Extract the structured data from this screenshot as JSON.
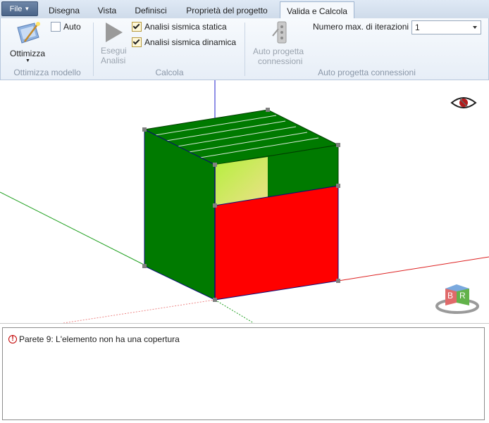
{
  "menu": {
    "file_label": "File",
    "tabs": [
      {
        "label": "Disegna"
      },
      {
        "label": "Vista"
      },
      {
        "label": "Definisci"
      },
      {
        "label": "Proprietà del progetto"
      },
      {
        "label": "Valida e Calcola"
      }
    ],
    "active_tab": "Valida e Calcola"
  },
  "ribbon": {
    "ottimizza": {
      "button_label": "Ottimizza",
      "auto_label": "Auto",
      "auto_checked": false,
      "group_label": "Ottimizza modello"
    },
    "calcola": {
      "run_label_1": "Esegui",
      "run_label_2": "Analisi",
      "static_label": "Analisi sismica statica",
      "static_checked": true,
      "dynamic_label": "Analisi sismica dinamica",
      "dynamic_checked": true,
      "group_label": "Calcola"
    },
    "connessioni": {
      "button_label_1": "Auto progetta",
      "button_label_2": "connessioni",
      "iterations_label": "Numero max. di iterazioni",
      "iterations_value": "1",
      "group_label": "Auto progetta connessioni"
    }
  },
  "viewport": {
    "visibility_icon": "eye-hidden-icon",
    "navigation_cube_icon": "view-cube-icon",
    "cube_labels": {
      "left": "B",
      "right": "R"
    },
    "colors": {
      "wall_green": "#007a00",
      "wall_red": "#ff0000",
      "opening": "#c8f05a",
      "axis_x": "#dd2020",
      "axis_y": "#20a020",
      "axis_z": "#2020cc"
    }
  },
  "messages": [
    {
      "icon": "warning-icon",
      "text": "Parete 9: L'elemento non ha una copertura"
    }
  ]
}
